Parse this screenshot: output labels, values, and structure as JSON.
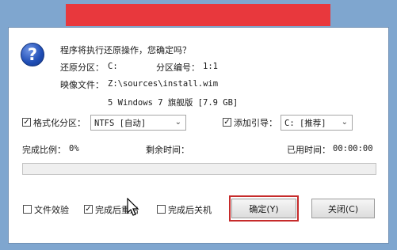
{
  "dialog": {
    "question": "程序将执行还原操作，您确定吗？",
    "restore_partition_label": "还原分区：",
    "restore_partition_value": "C:",
    "partition_number_label": "分区编号：",
    "partition_number_value": "1:1",
    "image_file_label": "映像文件：",
    "image_file_value": "Z:\\sources\\install.wim",
    "image_detail": "5 Windows 7 旗舰版 [7.9 GB]"
  },
  "options": {
    "format_partition": {
      "label": "格式化分区：",
      "checked": true,
      "select_value": "NTFS [自动]"
    },
    "add_boot": {
      "label": "添加引导：",
      "checked": true,
      "select_value": "C: [推荐]"
    }
  },
  "progress": {
    "ratio_label": "完成比例：",
    "ratio_value": "0%",
    "remaining_label": "剩余时间：",
    "remaining_value": "",
    "elapsed_label": "已用时间：",
    "elapsed_value": "00:00:00",
    "fraction": 0
  },
  "footer": {
    "verify_label": "文件效验",
    "verify_checked": false,
    "restart_label": "完成后重启",
    "restart_checked": true,
    "shutdown_label": "完成后关机",
    "shutdown_checked": false,
    "ok_button": "确定(Y)",
    "close_button": "关闭(C)"
  },
  "check_mark": "✓",
  "colors": {
    "title_bar": "#e8383d",
    "frame": "#7fa6cf",
    "progress_fill": "#06b025",
    "focus_border": "#c62b2b"
  },
  "icons": {
    "dialog": "question-icon",
    "cursor": "arrow-cursor-icon"
  }
}
